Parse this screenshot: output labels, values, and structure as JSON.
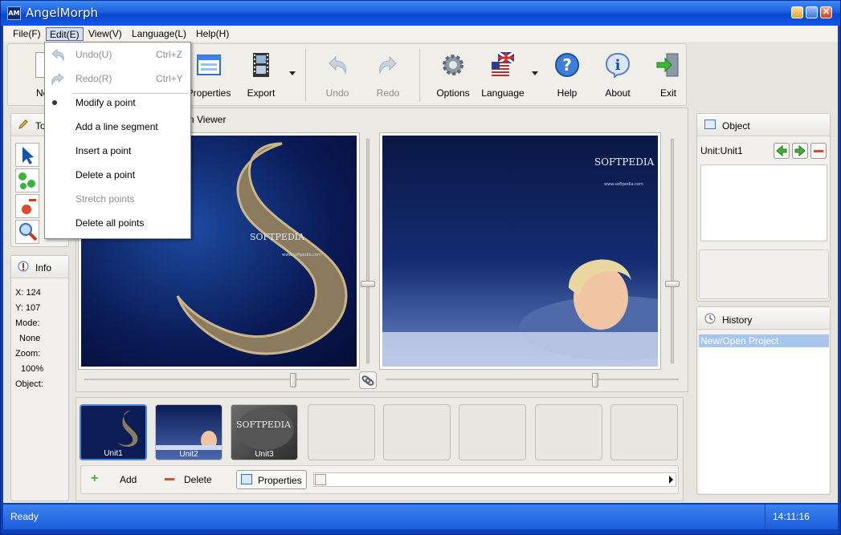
{
  "window": {
    "app_icon": "AM",
    "title": "AngelMorph",
    "close_glyph": "✕"
  },
  "menu": [
    {
      "label": "File(F)"
    },
    {
      "label": "Edit(E)"
    },
    {
      "label": "View(V)"
    },
    {
      "label": "Language(L)"
    },
    {
      "label": "Help(H)"
    }
  ],
  "toolbar": {
    "new_label_partial": "Ne",
    "properties_label_partial": "Properties",
    "export_label": "Export",
    "undo_label": "Undo",
    "redo_label": "Redo",
    "options_label": "Options",
    "language_label": "Language",
    "help_label": "Help",
    "about_label": "About",
    "exit_label": "Exit"
  },
  "edit_menu": {
    "undo": {
      "label": "Undo(U)",
      "shortcut": "Ctrl+Z"
    },
    "redo": {
      "label": "Redo(R)",
      "shortcut": "Ctrl+Y"
    },
    "modify_point": "Modify a point",
    "add_line_segment": "Add a line segment",
    "insert_point": "Insert a point",
    "delete_point": "Delete a point",
    "stretch_points": "Stretch points",
    "delete_all_points": "Delete all points"
  },
  "tools_panel": {
    "title_partial": "To"
  },
  "info_panel": {
    "title": "Info",
    "x_label": "X:",
    "x_value": "124",
    "y_label": "Y:",
    "y_value": "107",
    "mode_label": "Mode:",
    "mode_value": "None",
    "zoom_label": "Zoom:",
    "zoom_value": "100%",
    "object_label": "Object:"
  },
  "viewer": {
    "title_partial": "n Viewer",
    "left_image_text": "SOFTPEDIA",
    "right_image_text": "SOFTPEDIA",
    "watermark_url": "www.softpedia.com"
  },
  "thumbnails": [
    {
      "caption": "Unit1",
      "selected": true
    },
    {
      "caption": "Unit2",
      "selected": false
    },
    {
      "caption": "Unit3",
      "selected": false,
      "image_text": "SOFTPEDIA"
    }
  ],
  "unit_bar": {
    "add_label": "Add",
    "delete_label": "Delete",
    "properties_label": "Properties"
  },
  "object_panel": {
    "title": "Object",
    "unit_label": "Unit:Unit1"
  },
  "history_panel": {
    "title": "History",
    "items": [
      "New/Open Project"
    ]
  },
  "statusbar": {
    "status": "Ready",
    "time": "14:11:16"
  },
  "colors": {
    "titlebar": "#1c5fe0",
    "selection": "#a8c6ec",
    "image_bg": "#0c1e5c"
  }
}
